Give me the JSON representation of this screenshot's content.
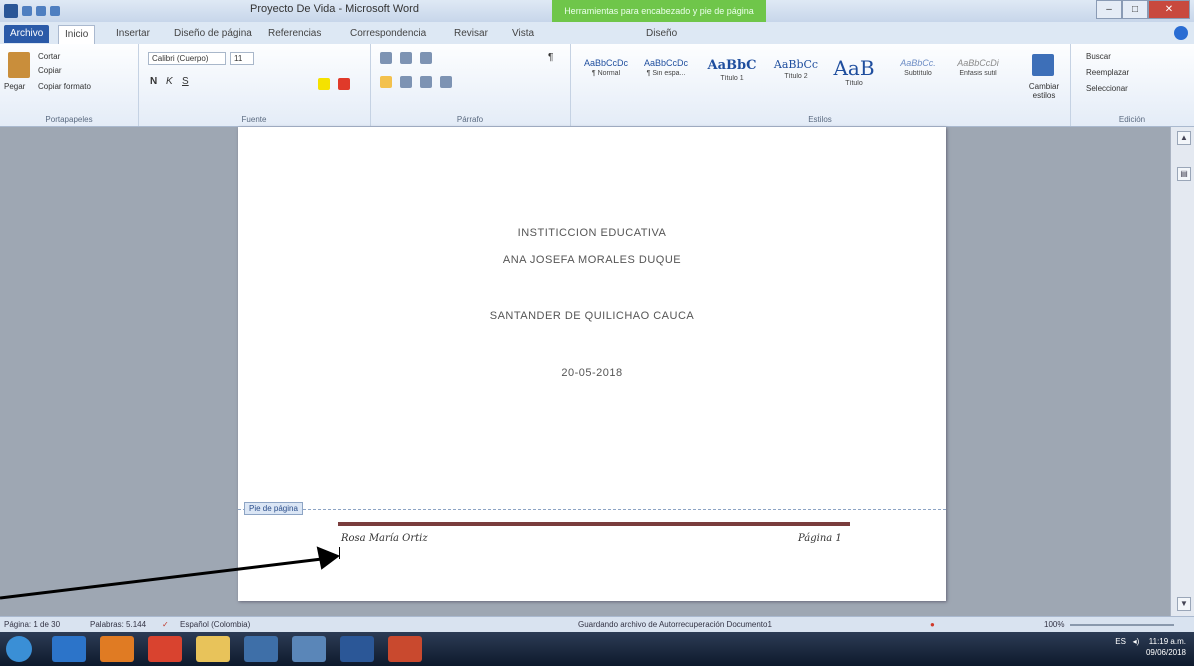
{
  "window": {
    "title": "Proyecto De Vida - Microsoft Word",
    "contextual_tab": "Herramientas para encabezado y pie de página",
    "controls": [
      "–",
      "□",
      "✕"
    ]
  },
  "tabs": [
    "Archivo",
    "Inicio",
    "Insertar",
    "Diseño de página",
    "Referencias",
    "Correspondencia",
    "Revisar",
    "Vista",
    "Diseño"
  ],
  "ribbon": {
    "clipboard": {
      "paste": "Pegar",
      "cut": "Cortar",
      "copy": "Copiar",
      "format_painter": "Copiar formato",
      "label": "Portapapeles"
    },
    "font": {
      "family": "Calibri (Cuerpo)",
      "size": "11",
      "label": "Fuente"
    },
    "paragraph": {
      "label": "Párrafo"
    },
    "styles": {
      "label": "Estilos",
      "items": [
        {
          "sample": "AaBbCcDc",
          "name": "¶ Normal"
        },
        {
          "sample": "AaBbCcDc",
          "name": "¶ Sin espa..."
        },
        {
          "sample": "AaBbC",
          "name": "Título 1"
        },
        {
          "sample": "AaBbCc",
          "name": "Título 2"
        },
        {
          "sample": "AaB",
          "name": "Título"
        },
        {
          "sample": "AaBbCc.",
          "name": "Subtítulo"
        },
        {
          "sample": "AaBbCcDi",
          "name": "Énfasis sutil"
        }
      ],
      "change": "Cambiar estilos"
    },
    "editing": {
      "find": "Buscar",
      "replace": "Reemplazar",
      "select": "Seleccionar",
      "label": "Edición"
    }
  },
  "document": {
    "line1": "INSTITICCION EDUCATIVA",
    "line2": "ANA JOSEFA MORALES DUQUE",
    "line3": "SANTANDER DE QUILICHAO  CAUCA",
    "date": "20-05-2018",
    "footer_tag": "Pie de página",
    "footer_left": "Rosa María Ortiz",
    "footer_right": "Página 1"
  },
  "status": {
    "page": "Página: 1 de 30",
    "words": "Palabras: 5.144",
    "language": "Español (Colombia)",
    "saving": "Guardando archivo de Autorrecuperación Documento1",
    "zoom": "100%"
  },
  "tray": {
    "lang": "ES",
    "time": "11:19 a.m.",
    "date": "09/06/2018"
  },
  "colors": {
    "file_tab": "#2a5aa8",
    "contextual": "#6fc64a",
    "footer_rule": "#7a3d3d"
  }
}
